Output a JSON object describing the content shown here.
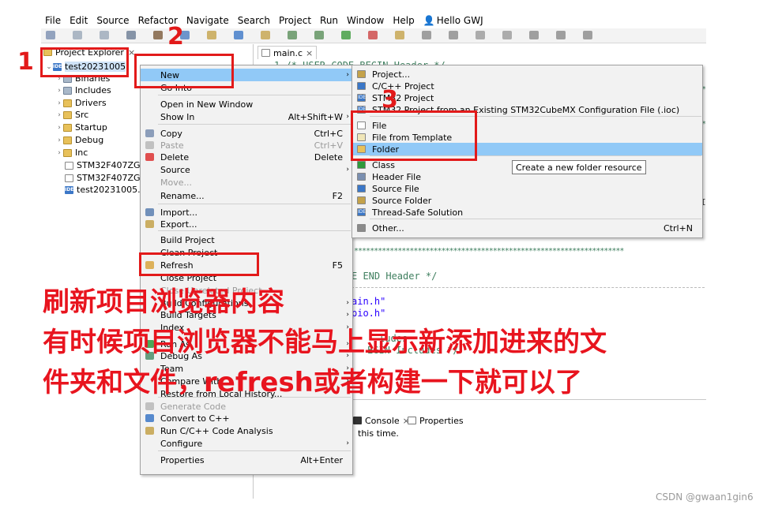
{
  "menubar": {
    "items": [
      "File",
      "Edit",
      "Source",
      "Refactor",
      "Navigate",
      "Search",
      "Project",
      "Run",
      "Window",
      "Help"
    ],
    "user": "Hello GWJ"
  },
  "project_explorer": {
    "title": "Project Explorer",
    "close": "×",
    "tree": [
      {
        "label": "test20231005",
        "icon": "ide-project-icon",
        "twisty": "⌄"
      },
      {
        "label": "Binaries",
        "icon": "binaries-icon",
        "twisty": "›"
      },
      {
        "label": "Includes",
        "icon": "includes-icon",
        "twisty": "›"
      },
      {
        "label": "Drivers",
        "icon": "folder-icon",
        "twisty": "›"
      },
      {
        "label": "Src",
        "icon": "folder-icon",
        "twisty": "›"
      },
      {
        "label": "Startup",
        "icon": "folder-icon",
        "twisty": "›"
      },
      {
        "label": "Debug",
        "icon": "folder-icon",
        "twisty": "›"
      },
      {
        "label": "Inc",
        "icon": "folder-icon",
        "twisty": "›"
      },
      {
        "label": "STM32F407ZGT",
        "icon": "file-icon",
        "twisty": ""
      },
      {
        "label": "STM32F407ZGT",
        "icon": "file-icon",
        "twisty": ""
      },
      {
        "label": "test20231005.io",
        "icon": "ide-file-icon",
        "twisty": ""
      }
    ]
  },
  "editor": {
    "tab_label": "main.c",
    "tab_close": "×",
    "code_line1": "1  /* USER CODE BEGIN Header */",
    "code_end_header": "E END Header */",
    "include1": "ain.h\"",
    "include2": "pio.h\"",
    "include3": "ludes",
    "include4": "EGIN Includes */",
    "stars": "********************************************************************",
    "right_marks": [
      "*",
      "*",
      "I"
    ]
  },
  "bottom": {
    "console_tab": "Console",
    "props_tab": "Properties",
    "console_text": "this time.",
    "close": "×"
  },
  "context_menu": {
    "items": [
      {
        "label": "New",
        "shortcut": "",
        "arrow": "›",
        "highlight": true,
        "disabled": false,
        "icon": ""
      },
      {
        "label": "Go Into",
        "shortcut": "",
        "arrow": "",
        "highlight": false,
        "disabled": false,
        "icon": ""
      },
      {
        "label": "Open in New Window",
        "shortcut": "",
        "arrow": "",
        "highlight": false,
        "disabled": false,
        "icon": ""
      },
      {
        "label": "Show In",
        "shortcut": "Alt+Shift+W",
        "arrow": "›",
        "highlight": false,
        "disabled": false,
        "icon": ""
      },
      {
        "label": "Copy",
        "shortcut": "Ctrl+C",
        "arrow": "",
        "highlight": false,
        "disabled": false,
        "icon": "copy-icon"
      },
      {
        "label": "Paste",
        "shortcut": "Ctrl+V",
        "arrow": "",
        "highlight": false,
        "disabled": true,
        "icon": "paste-icon"
      },
      {
        "label": "Delete",
        "shortcut": "Delete",
        "arrow": "",
        "highlight": false,
        "disabled": false,
        "icon": "delete-icon"
      },
      {
        "label": "Source",
        "shortcut": "",
        "arrow": "›",
        "highlight": false,
        "disabled": false,
        "icon": ""
      },
      {
        "label": "Move...",
        "shortcut": "",
        "arrow": "",
        "highlight": false,
        "disabled": true,
        "icon": ""
      },
      {
        "label": "Rename...",
        "shortcut": "F2",
        "arrow": "",
        "highlight": false,
        "disabled": false,
        "icon": ""
      },
      {
        "label": "Import...",
        "shortcut": "",
        "arrow": "",
        "highlight": false,
        "disabled": false,
        "icon": "import-icon"
      },
      {
        "label": "Export...",
        "shortcut": "",
        "arrow": "",
        "highlight": false,
        "disabled": false,
        "icon": "export-icon"
      },
      {
        "label": "Build Project",
        "shortcut": "",
        "arrow": "",
        "highlight": false,
        "disabled": false,
        "icon": ""
      },
      {
        "label": "Clean Project",
        "shortcut": "",
        "arrow": "",
        "highlight": false,
        "disabled": false,
        "icon": ""
      },
      {
        "label": "Refresh",
        "shortcut": "F5",
        "arrow": "",
        "highlight": false,
        "disabled": false,
        "icon": "refresh-icon"
      },
      {
        "label": "Close Project",
        "shortcut": "",
        "arrow": "",
        "highlight": false,
        "disabled": false,
        "icon": ""
      },
      {
        "label": "Close Unrelated Project",
        "shortcut": "",
        "arrow": "",
        "highlight": false,
        "disabled": true,
        "icon": ""
      },
      {
        "label": "Build Configurations",
        "shortcut": "",
        "arrow": "›",
        "highlight": false,
        "disabled": false,
        "icon": ""
      },
      {
        "label": "Build Targets",
        "shortcut": "",
        "arrow": "›",
        "highlight": false,
        "disabled": false,
        "icon": ""
      },
      {
        "label": "Index",
        "shortcut": "",
        "arrow": "›",
        "highlight": false,
        "disabled": false,
        "icon": ""
      },
      {
        "label": "Run As",
        "shortcut": "",
        "arrow": "›",
        "highlight": false,
        "disabled": false,
        "icon": "run-icon"
      },
      {
        "label": "Debug As",
        "shortcut": "",
        "arrow": "›",
        "highlight": false,
        "disabled": false,
        "icon": "debug-icon"
      },
      {
        "label": "Team",
        "shortcut": "",
        "arrow": "›",
        "highlight": false,
        "disabled": false,
        "icon": ""
      },
      {
        "label": "Compare With",
        "shortcut": "",
        "arrow": "›",
        "highlight": false,
        "disabled": false,
        "icon": ""
      },
      {
        "label": "Restore from Local History...",
        "shortcut": "",
        "arrow": "",
        "highlight": false,
        "disabled": false,
        "icon": ""
      },
      {
        "label": "Generate Code",
        "shortcut": "",
        "arrow": "",
        "highlight": false,
        "disabled": true,
        "icon": "generate-code-icon"
      },
      {
        "label": "Convert to C++",
        "shortcut": "",
        "arrow": "",
        "highlight": false,
        "disabled": false,
        "icon": "convert-cpp-icon"
      },
      {
        "label": "Run C/C++ Code Analysis",
        "shortcut": "",
        "arrow": "",
        "highlight": false,
        "disabled": false,
        "icon": "code-analysis-icon"
      },
      {
        "label": "Configure",
        "shortcut": "",
        "arrow": "›",
        "highlight": false,
        "disabled": false,
        "icon": ""
      },
      {
        "label": "Properties",
        "shortcut": "Alt+Enter",
        "arrow": "",
        "highlight": false,
        "disabled": false,
        "icon": ""
      }
    ]
  },
  "submenu": {
    "items": [
      {
        "label": "Project...",
        "shortcut": "",
        "highlight": false,
        "icon": "project-icon"
      },
      {
        "label": "C/C++ Project",
        "shortcut": "",
        "highlight": false,
        "icon": "c-project-icon"
      },
      {
        "label": "STM32 Project",
        "shortcut": "",
        "highlight": false,
        "icon": "ide-icon"
      },
      {
        "label": "STM32 Project from an Existing STM32CubeMX Configuration File (.ioc)",
        "shortcut": "",
        "highlight": false,
        "icon": "ide-icon"
      },
      {
        "label": "File",
        "shortcut": "",
        "highlight": false,
        "icon": "file-icon"
      },
      {
        "label": "File from Template",
        "shortcut": "",
        "highlight": false,
        "icon": "file-template-icon"
      },
      {
        "label": "Folder",
        "shortcut": "",
        "highlight": true,
        "icon": "folder-icon"
      },
      {
        "label": "Class",
        "shortcut": "",
        "highlight": false,
        "icon": "class-icon"
      },
      {
        "label": "Header File",
        "shortcut": "",
        "highlight": false,
        "icon": "header-file-icon"
      },
      {
        "label": "Source File",
        "shortcut": "",
        "highlight": false,
        "icon": "source-file-icon"
      },
      {
        "label": "Source Folder",
        "shortcut": "",
        "highlight": false,
        "icon": "source-folder-icon"
      },
      {
        "label": "Thread-Safe Solution",
        "shortcut": "",
        "highlight": false,
        "icon": "ide-icon"
      },
      {
        "label": "Other...",
        "shortcut": "Ctrl+N",
        "highlight": false,
        "icon": "other-icon"
      }
    ],
    "tooltip": "Create a new folder resource"
  },
  "annotations": {
    "num1": "1",
    "num2": "2",
    "num3": "3",
    "line1": "刷新项目浏览器内容",
    "line2": "有时候项目浏览器不能马上显示新添加进来的文",
    "line3": "件夹和文件，refresh或者构建一下就可以了",
    "color": "#e21a1a"
  },
  "watermark": "CSDN @gwaan1gin6",
  "colors": {
    "highlight": "#91c9f7",
    "menu_bg": "#f2f2f2",
    "comment": "#3f7f5f",
    "string": "#2a00ff"
  }
}
